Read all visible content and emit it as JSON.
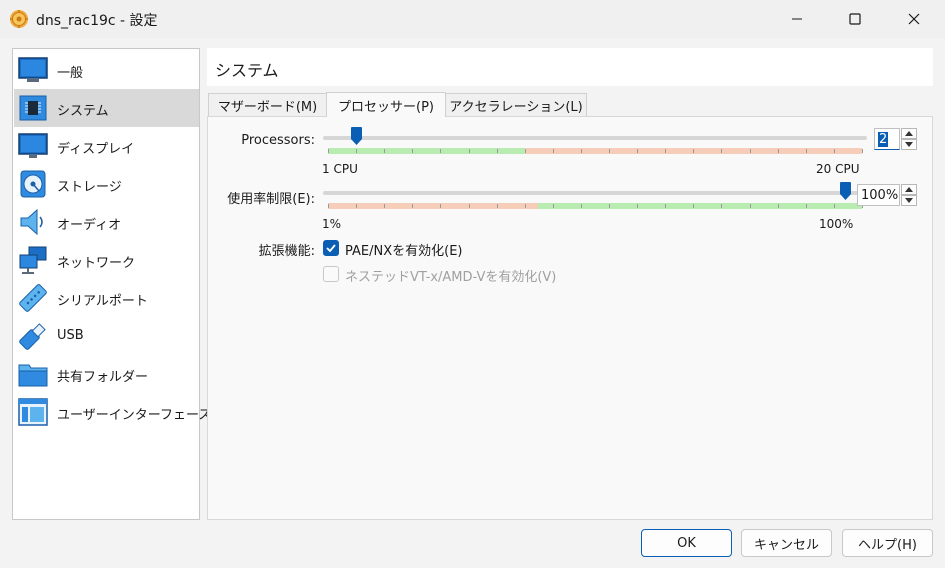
{
  "window": {
    "title": "dns_rac19c - 設定",
    "app_icon": "virtualbox-gear-icon"
  },
  "sidebar": {
    "items": [
      {
        "label": "一般",
        "icon": "monitor-icon"
      },
      {
        "label": "システム",
        "icon": "chip-icon",
        "selected": true
      },
      {
        "label": "ディスプレイ",
        "icon": "display-icon"
      },
      {
        "label": "ストレージ",
        "icon": "disk-icon"
      },
      {
        "label": "オーディオ",
        "icon": "speaker-icon"
      },
      {
        "label": "ネットワーク",
        "icon": "network-icon"
      },
      {
        "label": "シリアルポート",
        "icon": "serial-port-icon"
      },
      {
        "label": "USB",
        "icon": "usb-icon"
      },
      {
        "label": "共有フォルダー",
        "icon": "folder-icon"
      },
      {
        "label": "ユーザーインターフェース",
        "icon": "ui-window-icon"
      }
    ]
  },
  "main": {
    "title": "システム",
    "tabs": [
      {
        "label": "マザーボード(M)"
      },
      {
        "label": "プロセッサー(P)",
        "active": true
      },
      {
        "label": "アクセラレーション(L)"
      }
    ]
  },
  "processor": {
    "processors": {
      "label": "Processors:",
      "value": "2",
      "min_label": "1 CPU",
      "max_label": "20 CPU",
      "min": 1,
      "max": 20,
      "current": 2,
      "recommended_max": 8
    },
    "cap": {
      "label": "使用率制限(E):",
      "value": "100%",
      "min_label": "1%",
      "max_label": "100%",
      "min": 1,
      "max": 100,
      "current": 100,
      "warning_below": 40
    },
    "features_label": "拡張機能:",
    "pae": {
      "label": "PAE/NXを有効化(E)",
      "checked": true
    },
    "nested": {
      "label": "ネステッドVT-x/AMD-Vを有効化(V)",
      "checked": false,
      "disabled": true
    }
  },
  "buttons": {
    "ok": "OK",
    "cancel": "キャンセル",
    "help": "ヘルプ(H)"
  },
  "colors": {
    "accent": "#0a5fb4",
    "ok_zone": "#b9ecb0",
    "warn_zone": "#f6cdb9"
  }
}
